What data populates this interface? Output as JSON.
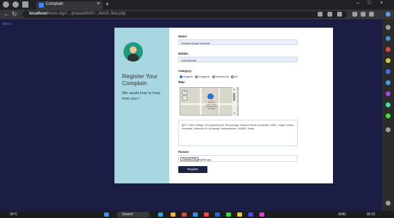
{
  "browser": {
    "tab_title": "Complain",
    "tab_close": "×",
    "new_tab": "+",
    "url_host": "localhost",
    "url_path": "/www.vlg/r/.../phase/MAP/.../fresh..fine.php",
    "window_controls": [
      "–",
      "□",
      "×"
    ]
  },
  "page_hint": "Menu",
  "left_panel": {
    "title": "Register Your Complain",
    "subtitle": "We would love to hear from you !"
  },
  "form": {
    "name_label": "Name:",
    "name_value": "Shrikant Dipak Dhanrut",
    "mobile_label": "Mobile:",
    "mobile_value": "1987898980",
    "category_label": "Category:",
    "categories": [
      "Organic",
      "Inorganic",
      "Household",
      "All"
    ],
    "category_selected": "Organic",
    "map_label": "Map:",
    "map_zoom_in": "+",
    "map_zoom_out": "−",
    "map_pin_text": [
      "P R Pote",
      "Patil College",
      "of Engineering",
      "Amravati"
    ],
    "address_value": "P. R. Pote College of Engineering & Technology, Kathora Road, Amravati, MIDC, Vijay Colony, Amravati, Kathora Kh, Amravati, Maharashtra, 444605, India",
    "picture_label": "Picture:",
    "choose_file_label": "Choose File",
    "file_name": "Organic.jpg",
    "submit_label": "Register"
  },
  "taskbar": {
    "weather": "26°C",
    "search_label": "Search",
    "lang": "ENG",
    "time": "18:13"
  },
  "colors": {
    "page_bg": "#1b1d44",
    "panel_bg": "#a8d6e2",
    "button_bg": "#1e2243",
    "avatar_bg": "#1f9a7c"
  }
}
